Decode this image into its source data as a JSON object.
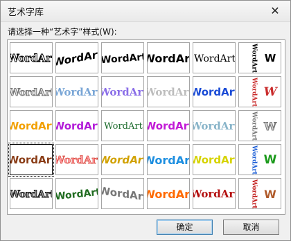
{
  "dialog": {
    "title": "艺术字库",
    "close_glyph": "✕",
    "prompt": "请选择一种“艺术字”样式(W):",
    "ok_label": "确定",
    "cancel_label": "取消"
  },
  "wordart": {
    "sample_text": "WordArt",
    "vertical_text": "WordArt"
  }
}
